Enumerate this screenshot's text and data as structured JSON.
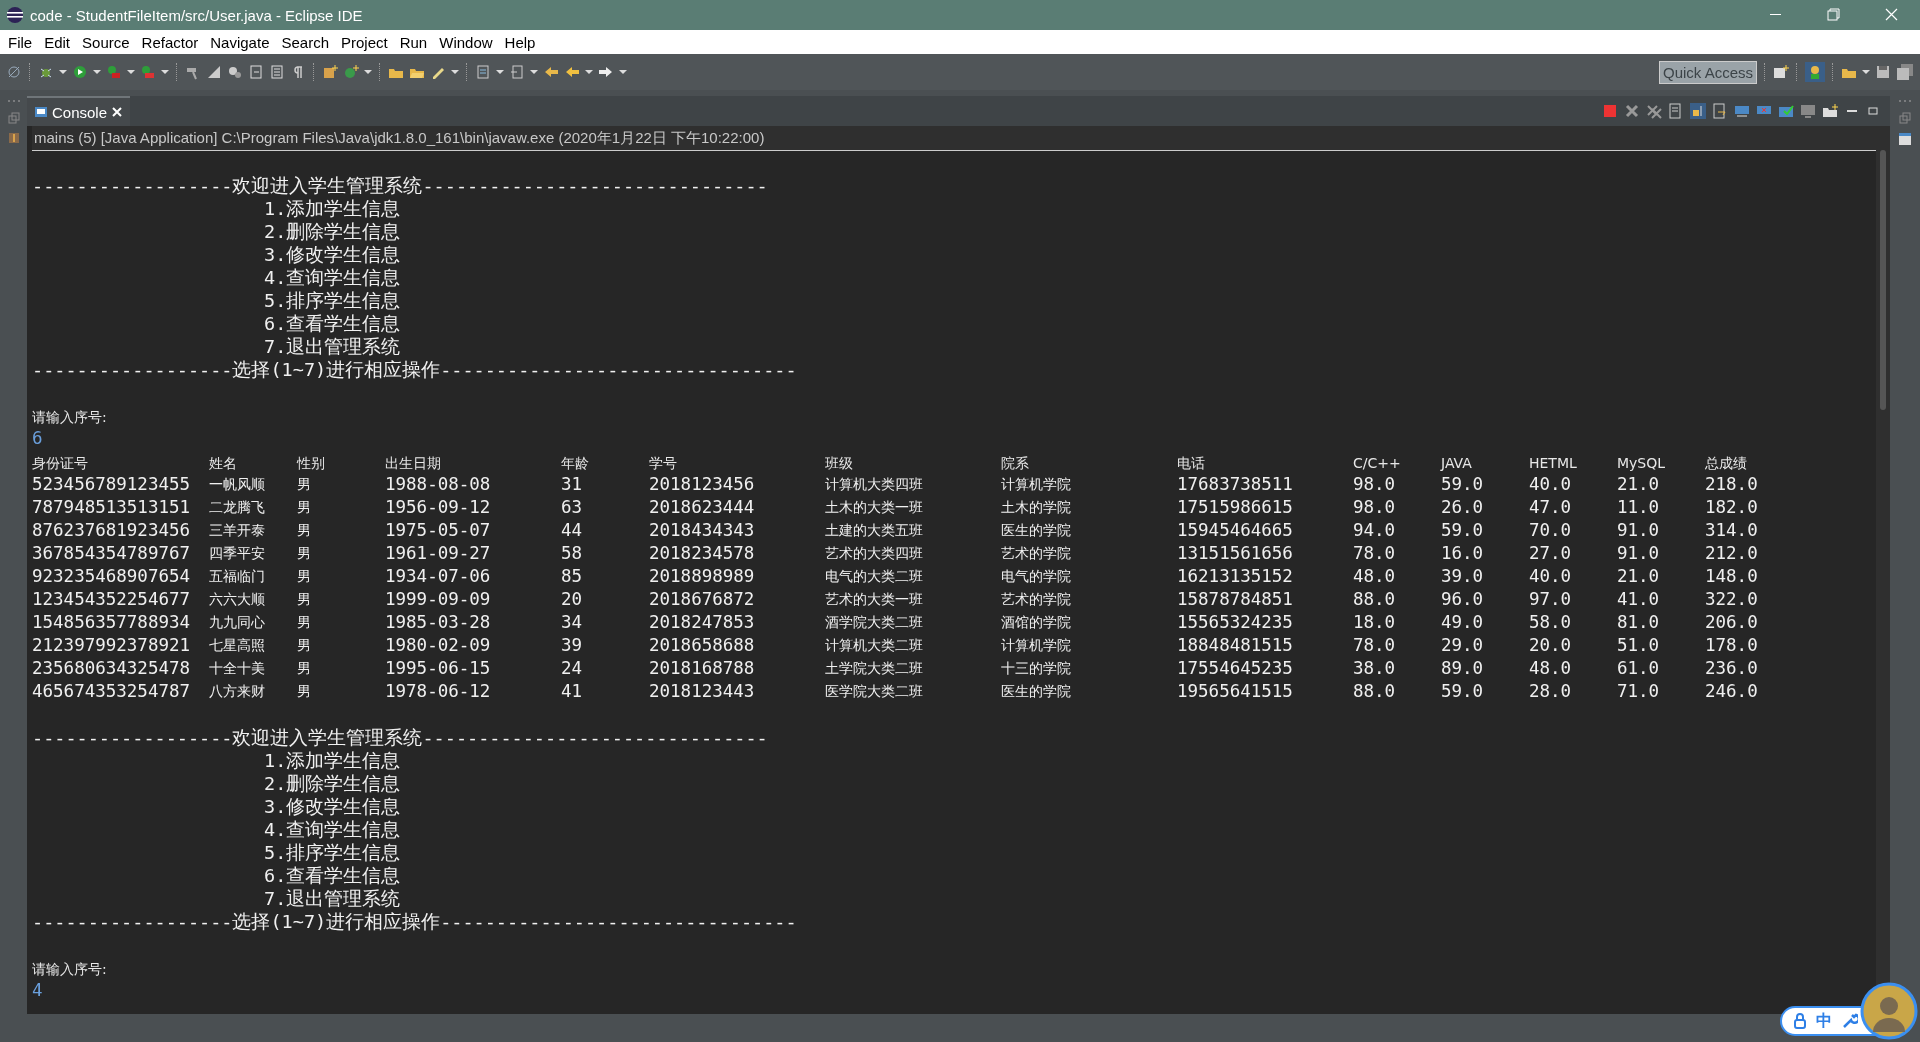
{
  "window": {
    "title": "code - StudentFileItem/src/User.java - Eclipse IDE"
  },
  "menu": [
    "File",
    "Edit",
    "Source",
    "Refactor",
    "Navigate",
    "Search",
    "Project",
    "Run",
    "Window",
    "Help"
  ],
  "toolbar": {
    "quick_access": "Quick Access"
  },
  "view": {
    "tab": {
      "label": "Console",
      "selected": true
    },
    "launch": "mains (5) [Java Application] C:\\Program Files\\Java\\jdk1.8.0_161\\bin\\javaw.exe (2020年1月22日 下午10:22:00)"
  },
  "console": [
    {
      "kind": "menu",
      "header": "------------------欢迎进入学生管理系统-------------------------------",
      "items": [
        "1.添加学生信息",
        "2.删除学生信息",
        "3.修改学生信息",
        "4.查询学生信息",
        "5.排序学生信息",
        "6.查看学生信息",
        "7.退出管理系统"
      ],
      "footer": "------------------选择(1~7)进行相应操作--------------------------------"
    },
    {
      "kind": "prompt",
      "text": "请输入序号:",
      "input": "6"
    },
    {
      "kind": "table",
      "columns": [
        "身份证号",
        "姓名",
        "性别",
        "出生日期",
        "年龄",
        "学号",
        "班级",
        "院系",
        "电话",
        "C/C++",
        "JAVA",
        "HETML",
        "MySQL",
        "总成绩"
      ],
      "rows": [
        [
          "523456789123455",
          "一帆风顺",
          "男",
          "1988-08-08",
          "31",
          "2018123456",
          "计算机大类四班",
          "计算机学院",
          "17683738511",
          "98.0",
          "59.0",
          "40.0",
          "21.0",
          "218.0"
        ],
        [
          "787948513513151",
          "二龙腾飞",
          "男",
          "1956-09-12",
          "63",
          "2018623444",
          "土木的大类一班",
          "土木的学院",
          "17515986615",
          "98.0",
          "26.0",
          "47.0",
          "11.0",
          "182.0"
        ],
        [
          "876237681923456",
          "三羊开泰",
          "男",
          "1975-05-07",
          "44",
          "2018434343",
          "土建的大类五班",
          "医生的学院",
          "15945464665",
          "94.0",
          "59.0",
          "70.0",
          "91.0",
          "314.0"
        ],
        [
          "367854354789767",
          "四季平安",
          "男",
          "1961-09-27",
          "58",
          "2018234578",
          "艺术的大类四班",
          "艺术的学院",
          "13151561656",
          "78.0",
          "16.0",
          "27.0",
          "91.0",
          "212.0"
        ],
        [
          "923235468907654",
          "五福临门",
          "男",
          "1934-07-06",
          "85",
          "2018898989",
          "电气的大类二班",
          "电气的学院",
          "16213135152",
          "48.0",
          "39.0",
          "40.0",
          "21.0",
          "148.0"
        ],
        [
          "123454352254677",
          "六六大顺",
          "男",
          "1999-09-09",
          "20",
          "2018676872",
          "艺术的大类一班",
          "艺术的学院",
          "15878784851",
          "88.0",
          "96.0",
          "97.0",
          "41.0",
          "322.0"
        ],
        [
          "154856357788934",
          "九九同心",
          "男",
          "1985-03-28",
          "34",
          "2018247853",
          "酒学院大类二班",
          "酒馆的学院",
          "15565324235",
          "18.0",
          "49.0",
          "58.0",
          "81.0",
          "206.0"
        ],
        [
          "212397992378921",
          "七星高照",
          "男",
          "1980-02-09",
          "39",
          "2018658688",
          "计算机大类二班",
          "计算机学院",
          "18848481515",
          "78.0",
          "29.0",
          "20.0",
          "51.0",
          "178.0"
        ],
        [
          "235680634325478",
          "十全十美",
          "男",
          "1995-06-15",
          "24",
          "2018168788",
          "土学院大类二班",
          "十三的学院",
          "17554645235",
          "38.0",
          "89.0",
          "48.0",
          "61.0",
          "236.0"
        ],
        [
          "465674353254787",
          "八方来财",
          "男",
          "1978-06-12",
          "41",
          "2018123443",
          "医学院大类二班",
          "医生的学院",
          "19565641515",
          "88.0",
          "59.0",
          "28.0",
          "71.0",
          "246.0"
        ]
      ]
    },
    {
      "kind": "menu",
      "header": "------------------欢迎进入学生管理系统-------------------------------",
      "items": [
        "1.添加学生信息",
        "2.删除学生信息",
        "3.修改学生信息",
        "4.查询学生信息",
        "5.排序学生信息",
        "6.查看学生信息",
        "7.退出管理系统"
      ],
      "footer": "------------------选择(1~7)进行相应操作--------------------------------"
    },
    {
      "kind": "prompt",
      "text": "请输入序号:",
      "input": "4"
    }
  ],
  "ime": {
    "mode": "中"
  }
}
